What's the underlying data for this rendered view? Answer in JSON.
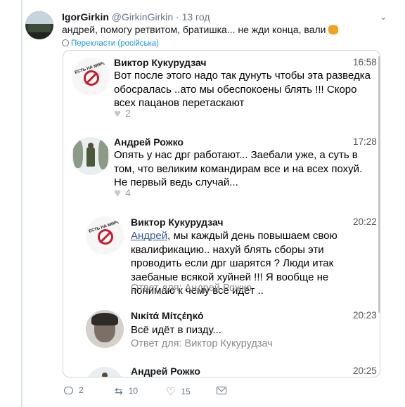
{
  "tweet": {
    "author_name": "IgorGirkin",
    "author_handle": "@GirkinGirkin",
    "separator": "·",
    "time": "13 год",
    "text": "андрей, помогу ретвитом, братишка... не жди конца, вали",
    "translate_label": "Перекласти (російська)",
    "actions": {
      "replies": "2",
      "retweets": "10",
      "likes": "15"
    }
  },
  "comments": [
    {
      "name": "Виктор Кукурудзач",
      "time": "16:58",
      "text": "Вот после этого надо так дунуть чтобы эта разведка обосралась ..ато мы обеспокоены блять !!! Скоро всех пацанов перетаскают",
      "likes": "2",
      "avatar_text": "ЕСТЬ НА МИРОТВОРЦЕ"
    },
    {
      "name": "Андрей Рожко",
      "time": "17:28",
      "text": "Опять у нас дрг работают... Заебали уже, а суть в том, что великим командирам все и на всех похуй. Не первый ведь случай...",
      "likes": "4"
    },
    {
      "name": "Виктор Кукурудзач",
      "time": "20:22",
      "mention": "Андрей",
      "text": ", мы каждый день повышаем свою квалификацию.. нахуй блять сборы эти проводить если дрг шарятся ? Люди итак заебаные всякой хуйней !!! Я вообще не понимаю к чему все идёт ..",
      "reply_to": "Ответ для: Андрей Рожко",
      "avatar_text": "ЕСТЬ НА МИРОТВОРЦЕ"
    },
    {
      "name": "Νικίτά Μίτςέηκό",
      "time": "20:23",
      "text": "Всё идёт в пизду...",
      "reply_to": "Ответ для: Виктор Кукурудзач"
    },
    {
      "name": "Андрей Рожко",
      "time": "20:25"
    }
  ],
  "colors": {
    "link": "#1b95e0",
    "mention": "#365899",
    "badge_red": "#c81e2c",
    "muted": "#657786"
  }
}
